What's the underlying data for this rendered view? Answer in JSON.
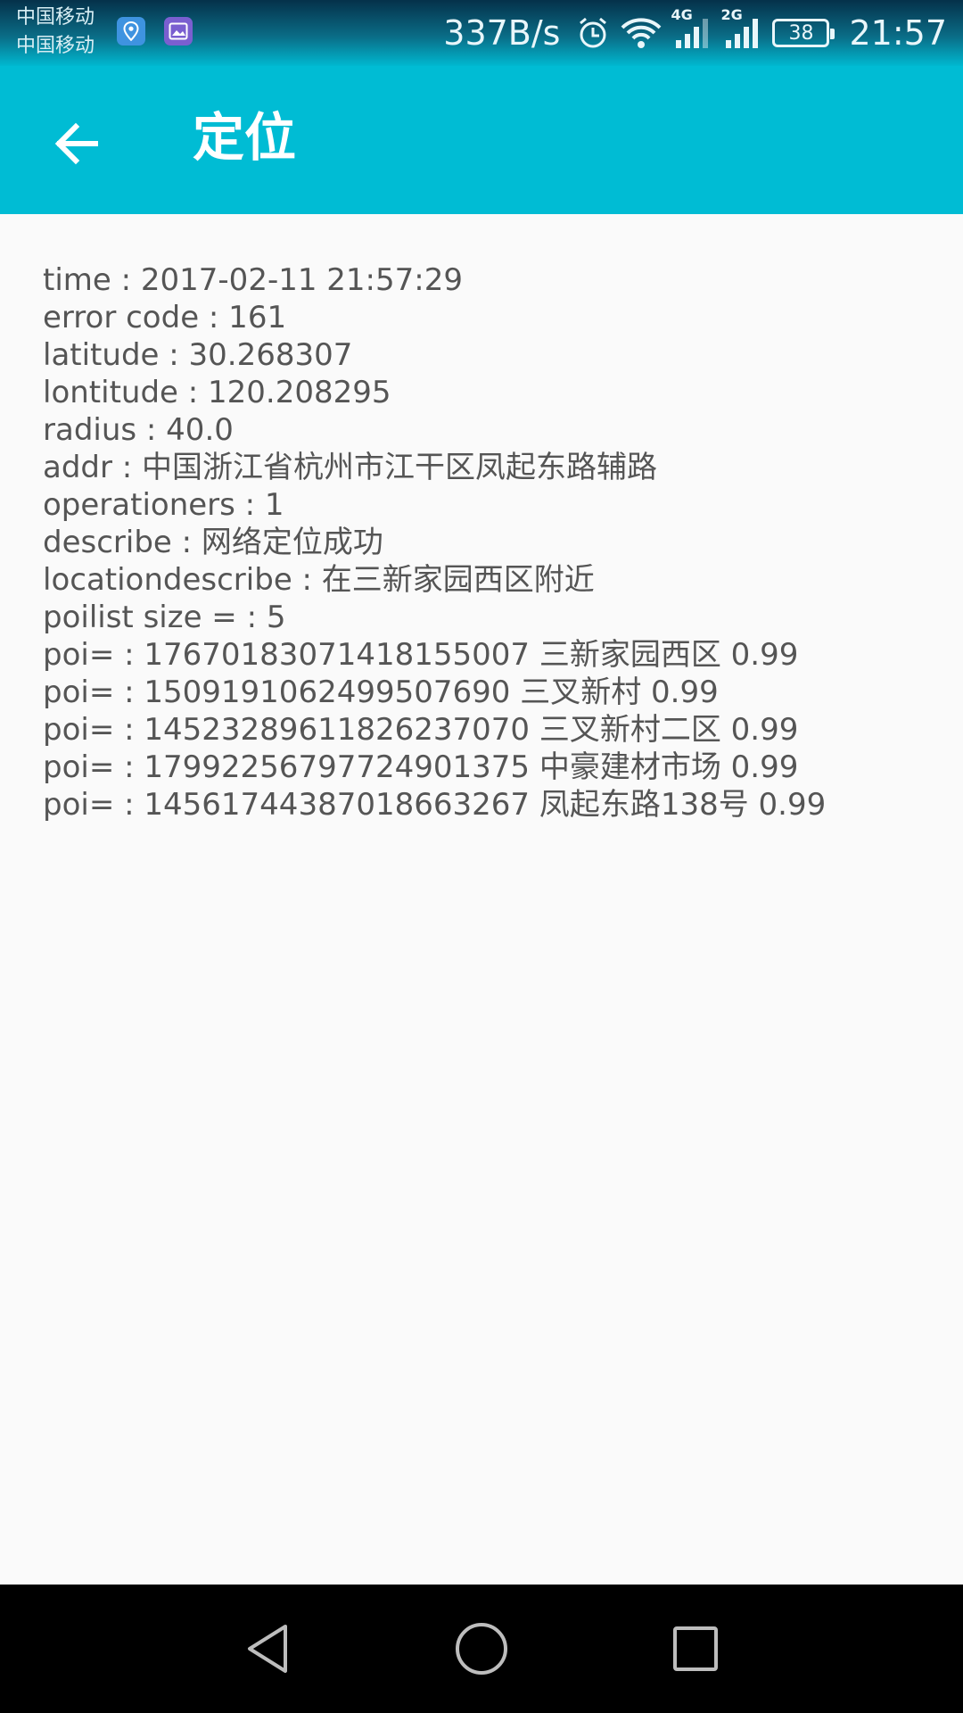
{
  "status_bar": {
    "carrier_1": "中国移动",
    "carrier_2": "中国移动",
    "net_speed": "337B/s",
    "gen_1": "4G",
    "gen_2": "2G",
    "battery": "38",
    "time": "21:57",
    "icons": [
      "location-notification-icon",
      "image-notification-icon",
      "alarm-icon",
      "wifi-icon",
      "signal-4g-icon",
      "signal-2g-icon",
      "battery-icon"
    ]
  },
  "app_bar": {
    "title": "定位",
    "back_icon": "arrow-left-icon",
    "color": "#00bcd4"
  },
  "content": {
    "lines": [
      "time : 2017-02-11 21:57:29",
      "error code : 161",
      "latitude : 30.268307",
      "lontitude : 120.208295",
      "radius : 40.0",
      "addr : 中国浙江省杭州市江干区凤起东路辅路",
      "operationers : 1",
      "describe : 网络定位成功",
      "locationdescribe : 在三新家园西区附近",
      "poilist size = : 5",
      "poi= : 1767018307141815500​7 三新家园西区 0.99",
      "poi= : 15091910624995076​90 三叉新村 0.99",
      "poi= : 14523289611826237070 三叉新村二区 0.99",
      "poi= : 17992256797724901375 中豪建材市场 0.99",
      "poi= : 14561744387018663267 凤起东路138号 0.99"
    ]
  },
  "nav_bar": {
    "buttons": [
      "back-triangle-icon",
      "home-circle-icon",
      "recents-square-icon"
    ]
  }
}
